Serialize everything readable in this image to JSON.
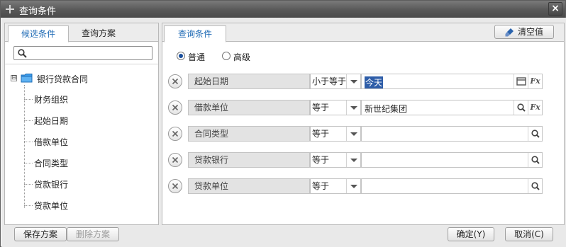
{
  "window": {
    "title": "查询条件",
    "close_label": "×"
  },
  "left_tabs": [
    {
      "label": "候选条件",
      "active": true
    },
    {
      "label": "查询方案",
      "active": false
    }
  ],
  "search": {
    "placeholder": "",
    "value": ""
  },
  "tree": {
    "root": {
      "label": "银行贷款合同",
      "expander": "⊟"
    },
    "items": [
      {
        "label": "财务组织"
      },
      {
        "label": "起始日期"
      },
      {
        "label": "借款单位"
      },
      {
        "label": "合同类型"
      },
      {
        "label": "贷款银行"
      },
      {
        "label": "贷款单位"
      }
    ]
  },
  "right_tab": {
    "label": "查询条件"
  },
  "clear_button": {
    "label": "清空值"
  },
  "mode": {
    "options": [
      {
        "label": "普通",
        "checked": true
      },
      {
        "label": "高级",
        "checked": false
      }
    ]
  },
  "conditions": [
    {
      "field": "起始日期",
      "operator": "小于等于",
      "value": "今天",
      "value_selected": true,
      "icon": "calendar-icon",
      "has_fx": true
    },
    {
      "field": "借款单位",
      "operator": "等于",
      "value": "新世纪集团",
      "value_selected": false,
      "icon": "search-icon",
      "has_fx": true
    },
    {
      "field": "合同类型",
      "operator": "等于",
      "value": "",
      "value_selected": false,
      "icon": "search-icon",
      "has_fx": false
    },
    {
      "field": "贷款银行",
      "operator": "等于",
      "value": "",
      "value_selected": false,
      "icon": "search-icon",
      "has_fx": false
    },
    {
      "field": "贷款单位",
      "operator": "等于",
      "value": "",
      "value_selected": false,
      "icon": "search-icon",
      "has_fx": false
    }
  ],
  "fx_label": "Fx",
  "footer": {
    "save_scheme": "保存方案",
    "delete_scheme": "删除方案",
    "ok": "确定(Y)",
    "cancel": "取消(C)"
  },
  "colors": {
    "accent": "#1c69b4",
    "selection": "#2e5da8",
    "titlebar": "#585858"
  }
}
